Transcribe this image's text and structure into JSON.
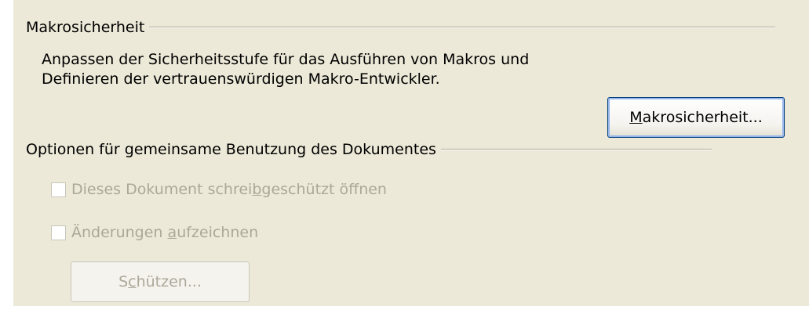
{
  "macro_security": {
    "group_title": "Makrosicherheit",
    "description": "Anpassen der Sicherheitsstufe für das Ausführen von Makros und Definieren der vertrauenswürdigen Makro-Entwickler.",
    "button": {
      "label_prefix": "",
      "mnemonic": "M",
      "label_suffix": "akrosicherheit..."
    }
  },
  "sharing_options": {
    "group_title": "Optionen für gemeinsame Benutzung des Dokumentes",
    "read_only": {
      "label_prefix": "Dieses Dokument schrei",
      "mnemonic": "b",
      "label_suffix": "geschützt öffnen",
      "checked": false,
      "enabled": false
    },
    "record_changes": {
      "label_prefix": "Änderungen ",
      "mnemonic": "a",
      "label_suffix": "ufzeichnen",
      "checked": false,
      "enabled": false
    },
    "protect_button": {
      "label_prefix": "S",
      "mnemonic": "c",
      "label_suffix": "hützen...",
      "enabled": false
    }
  }
}
